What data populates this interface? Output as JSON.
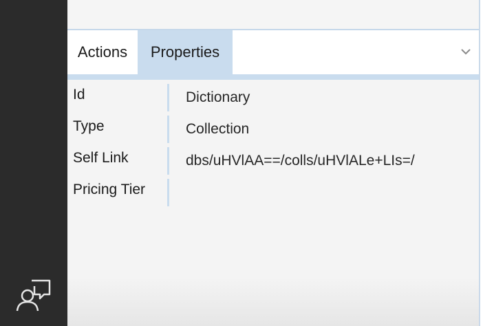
{
  "tabs": {
    "actions_label": "Actions",
    "properties_label": "Properties"
  },
  "properties": [
    {
      "key": "Id",
      "value": "Dictionary"
    },
    {
      "key": "Type",
      "value": "Collection"
    },
    {
      "key": "Self Link",
      "value": "dbs/uHVlAA==/colls/uHVlALe+LIs=/"
    },
    {
      "key": "Pricing Tier",
      "value": ""
    }
  ],
  "icons": {
    "left_rail": "feedback-icon",
    "tab_strip": "chevron-down-icon"
  },
  "colors": {
    "left_rail": "#2b2b2b",
    "active_tab": "#c9dcee",
    "panel_background": "#f2f2f2"
  }
}
